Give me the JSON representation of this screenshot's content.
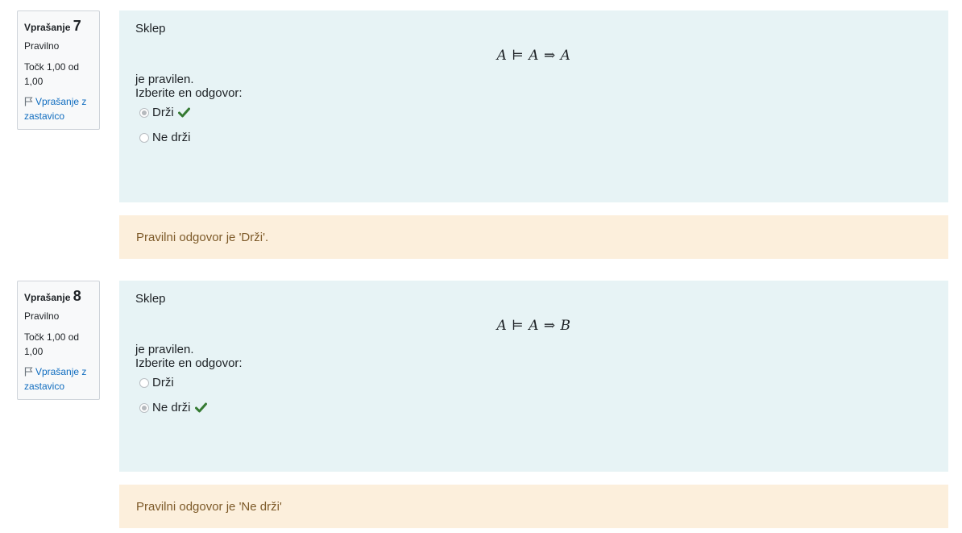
{
  "questions": [
    {
      "label": "Vprašanje",
      "number": "7",
      "state": "Pravilno",
      "grade": "Točk 1,00 od 1,00",
      "flag_label": "Vprašanje z zastavico",
      "intro": "Sklep",
      "formula": {
        "left": "A",
        "turnstile": "⊨",
        "premise": "A",
        "arrow": "⇒",
        "conclusion": "A"
      },
      "after": "je pravilen.",
      "prompt": "Izberite en odgovor:",
      "answers": [
        {
          "label": "Drži",
          "checked": true,
          "correct_mark": true
        },
        {
          "label": "Ne drži",
          "checked": false,
          "correct_mark": false
        }
      ],
      "feedback": "Pravilni odgovor je 'Drži'."
    },
    {
      "label": "Vprašanje",
      "number": "8",
      "state": "Pravilno",
      "grade": "Točk 1,00 od 1,00",
      "flag_label": "Vprašanje z zastavico",
      "intro": "Sklep",
      "formula": {
        "left": "A",
        "turnstile": "⊨",
        "premise": "A",
        "arrow": "⇒",
        "conclusion": "B"
      },
      "after": "je pravilen.",
      "prompt": "Izberite en odgovor:",
      "answers": [
        {
          "label": "Drži",
          "checked": false,
          "correct_mark": false
        },
        {
          "label": "Ne drži",
          "checked": true,
          "correct_mark": true
        }
      ],
      "feedback": "Pravilni odgovor je 'Ne drži'"
    }
  ],
  "colors": {
    "correct_check": "#357a32",
    "link": "#0f6cbf",
    "formulation_bg": "#e7f3f5",
    "feedback_bg": "#fcefdc",
    "feedback_text": "#7d5a29"
  },
  "icons": {
    "flag": "flag-icon",
    "correct": "check-icon"
  }
}
